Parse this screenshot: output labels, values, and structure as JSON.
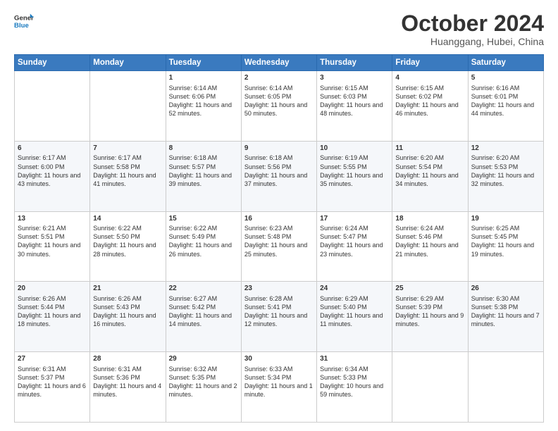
{
  "header": {
    "logo_line1": "General",
    "logo_line2": "Blue",
    "month": "October 2024",
    "location": "Huanggang, Hubei, China"
  },
  "weekdays": [
    "Sunday",
    "Monday",
    "Tuesday",
    "Wednesday",
    "Thursday",
    "Friday",
    "Saturday"
  ],
  "weeks": [
    [
      {
        "day": "",
        "info": ""
      },
      {
        "day": "",
        "info": ""
      },
      {
        "day": "1",
        "info": "Sunrise: 6:14 AM\nSunset: 6:06 PM\nDaylight: 11 hours and 52 minutes."
      },
      {
        "day": "2",
        "info": "Sunrise: 6:14 AM\nSunset: 6:05 PM\nDaylight: 11 hours and 50 minutes."
      },
      {
        "day": "3",
        "info": "Sunrise: 6:15 AM\nSunset: 6:03 PM\nDaylight: 11 hours and 48 minutes."
      },
      {
        "day": "4",
        "info": "Sunrise: 6:15 AM\nSunset: 6:02 PM\nDaylight: 11 hours and 46 minutes."
      },
      {
        "day": "5",
        "info": "Sunrise: 6:16 AM\nSunset: 6:01 PM\nDaylight: 11 hours and 44 minutes."
      }
    ],
    [
      {
        "day": "6",
        "info": "Sunrise: 6:17 AM\nSunset: 6:00 PM\nDaylight: 11 hours and 43 minutes."
      },
      {
        "day": "7",
        "info": "Sunrise: 6:17 AM\nSunset: 5:58 PM\nDaylight: 11 hours and 41 minutes."
      },
      {
        "day": "8",
        "info": "Sunrise: 6:18 AM\nSunset: 5:57 PM\nDaylight: 11 hours and 39 minutes."
      },
      {
        "day": "9",
        "info": "Sunrise: 6:18 AM\nSunset: 5:56 PM\nDaylight: 11 hours and 37 minutes."
      },
      {
        "day": "10",
        "info": "Sunrise: 6:19 AM\nSunset: 5:55 PM\nDaylight: 11 hours and 35 minutes."
      },
      {
        "day": "11",
        "info": "Sunrise: 6:20 AM\nSunset: 5:54 PM\nDaylight: 11 hours and 34 minutes."
      },
      {
        "day": "12",
        "info": "Sunrise: 6:20 AM\nSunset: 5:53 PM\nDaylight: 11 hours and 32 minutes."
      }
    ],
    [
      {
        "day": "13",
        "info": "Sunrise: 6:21 AM\nSunset: 5:51 PM\nDaylight: 11 hours and 30 minutes."
      },
      {
        "day": "14",
        "info": "Sunrise: 6:22 AM\nSunset: 5:50 PM\nDaylight: 11 hours and 28 minutes."
      },
      {
        "day": "15",
        "info": "Sunrise: 6:22 AM\nSunset: 5:49 PM\nDaylight: 11 hours and 26 minutes."
      },
      {
        "day": "16",
        "info": "Sunrise: 6:23 AM\nSunset: 5:48 PM\nDaylight: 11 hours and 25 minutes."
      },
      {
        "day": "17",
        "info": "Sunrise: 6:24 AM\nSunset: 5:47 PM\nDaylight: 11 hours and 23 minutes."
      },
      {
        "day": "18",
        "info": "Sunrise: 6:24 AM\nSunset: 5:46 PM\nDaylight: 11 hours and 21 minutes."
      },
      {
        "day": "19",
        "info": "Sunrise: 6:25 AM\nSunset: 5:45 PM\nDaylight: 11 hours and 19 minutes."
      }
    ],
    [
      {
        "day": "20",
        "info": "Sunrise: 6:26 AM\nSunset: 5:44 PM\nDaylight: 11 hours and 18 minutes."
      },
      {
        "day": "21",
        "info": "Sunrise: 6:26 AM\nSunset: 5:43 PM\nDaylight: 11 hours and 16 minutes."
      },
      {
        "day": "22",
        "info": "Sunrise: 6:27 AM\nSunset: 5:42 PM\nDaylight: 11 hours and 14 minutes."
      },
      {
        "day": "23",
        "info": "Sunrise: 6:28 AM\nSunset: 5:41 PM\nDaylight: 11 hours and 12 minutes."
      },
      {
        "day": "24",
        "info": "Sunrise: 6:29 AM\nSunset: 5:40 PM\nDaylight: 11 hours and 11 minutes."
      },
      {
        "day": "25",
        "info": "Sunrise: 6:29 AM\nSunset: 5:39 PM\nDaylight: 11 hours and 9 minutes."
      },
      {
        "day": "26",
        "info": "Sunrise: 6:30 AM\nSunset: 5:38 PM\nDaylight: 11 hours and 7 minutes."
      }
    ],
    [
      {
        "day": "27",
        "info": "Sunrise: 6:31 AM\nSunset: 5:37 PM\nDaylight: 11 hours and 6 minutes."
      },
      {
        "day": "28",
        "info": "Sunrise: 6:31 AM\nSunset: 5:36 PM\nDaylight: 11 hours and 4 minutes."
      },
      {
        "day": "29",
        "info": "Sunrise: 6:32 AM\nSunset: 5:35 PM\nDaylight: 11 hours and 2 minutes."
      },
      {
        "day": "30",
        "info": "Sunrise: 6:33 AM\nSunset: 5:34 PM\nDaylight: 11 hours and 1 minute."
      },
      {
        "day": "31",
        "info": "Sunrise: 6:34 AM\nSunset: 5:33 PM\nDaylight: 10 hours and 59 minutes."
      },
      {
        "day": "",
        "info": ""
      },
      {
        "day": "",
        "info": ""
      }
    ]
  ]
}
